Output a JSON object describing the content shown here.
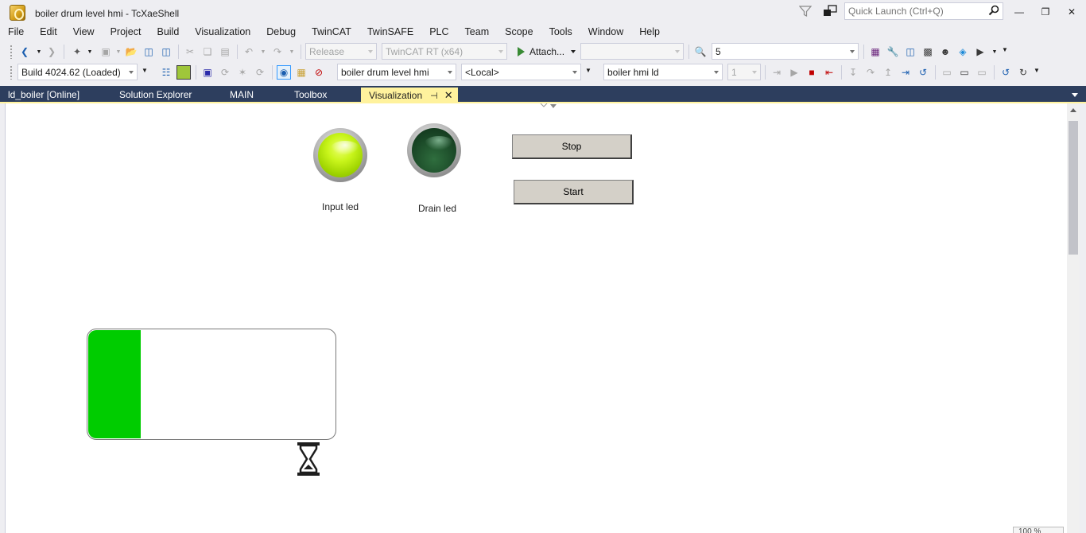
{
  "window": {
    "title": "boiler drum level hmi - TcXaeShell",
    "quick_launch_placeholder": "Quick Launch (Ctrl+Q)",
    "minimize": "—",
    "restore": "❐",
    "close": "✕"
  },
  "menu": [
    "File",
    "Edit",
    "View",
    "Project",
    "Build",
    "Visualization",
    "Debug",
    "TwinCAT",
    "TwinSAFE",
    "PLC",
    "Team",
    "Scope",
    "Tools",
    "Window",
    "Help"
  ],
  "toolbar1": {
    "config": "Release",
    "platform": "TwinCAT RT (x64)",
    "attach": "Attach...",
    "attach_target": "",
    "find_value": "5"
  },
  "toolbar2": {
    "build": "Build 4024.62 (Loaded)",
    "project": "boiler drum level hmi",
    "target": "<Local>",
    "plc": "boiler hmi ld",
    "instance": "1"
  },
  "tabs": [
    {
      "label": "ld_boiler [Online]",
      "active": false
    },
    {
      "label": "Solution Explorer",
      "active": false
    },
    {
      "label": "MAIN",
      "active": false
    },
    {
      "label": "Toolbox",
      "active": false
    },
    {
      "label": "Visualization",
      "active": true
    }
  ],
  "hmi": {
    "input_led_label": "Input led",
    "input_led_state": "on",
    "drain_led_label": "Drain led",
    "drain_led_state": "off",
    "stop_label": "Stop",
    "start_label": "Start",
    "tank_level_fraction": 0.21,
    "tank_fill_color": "#00cc00",
    "led_on_color": "#c9f51b",
    "led_off_color": "#1b4a28"
  },
  "status": {
    "zoom": "100 %"
  }
}
